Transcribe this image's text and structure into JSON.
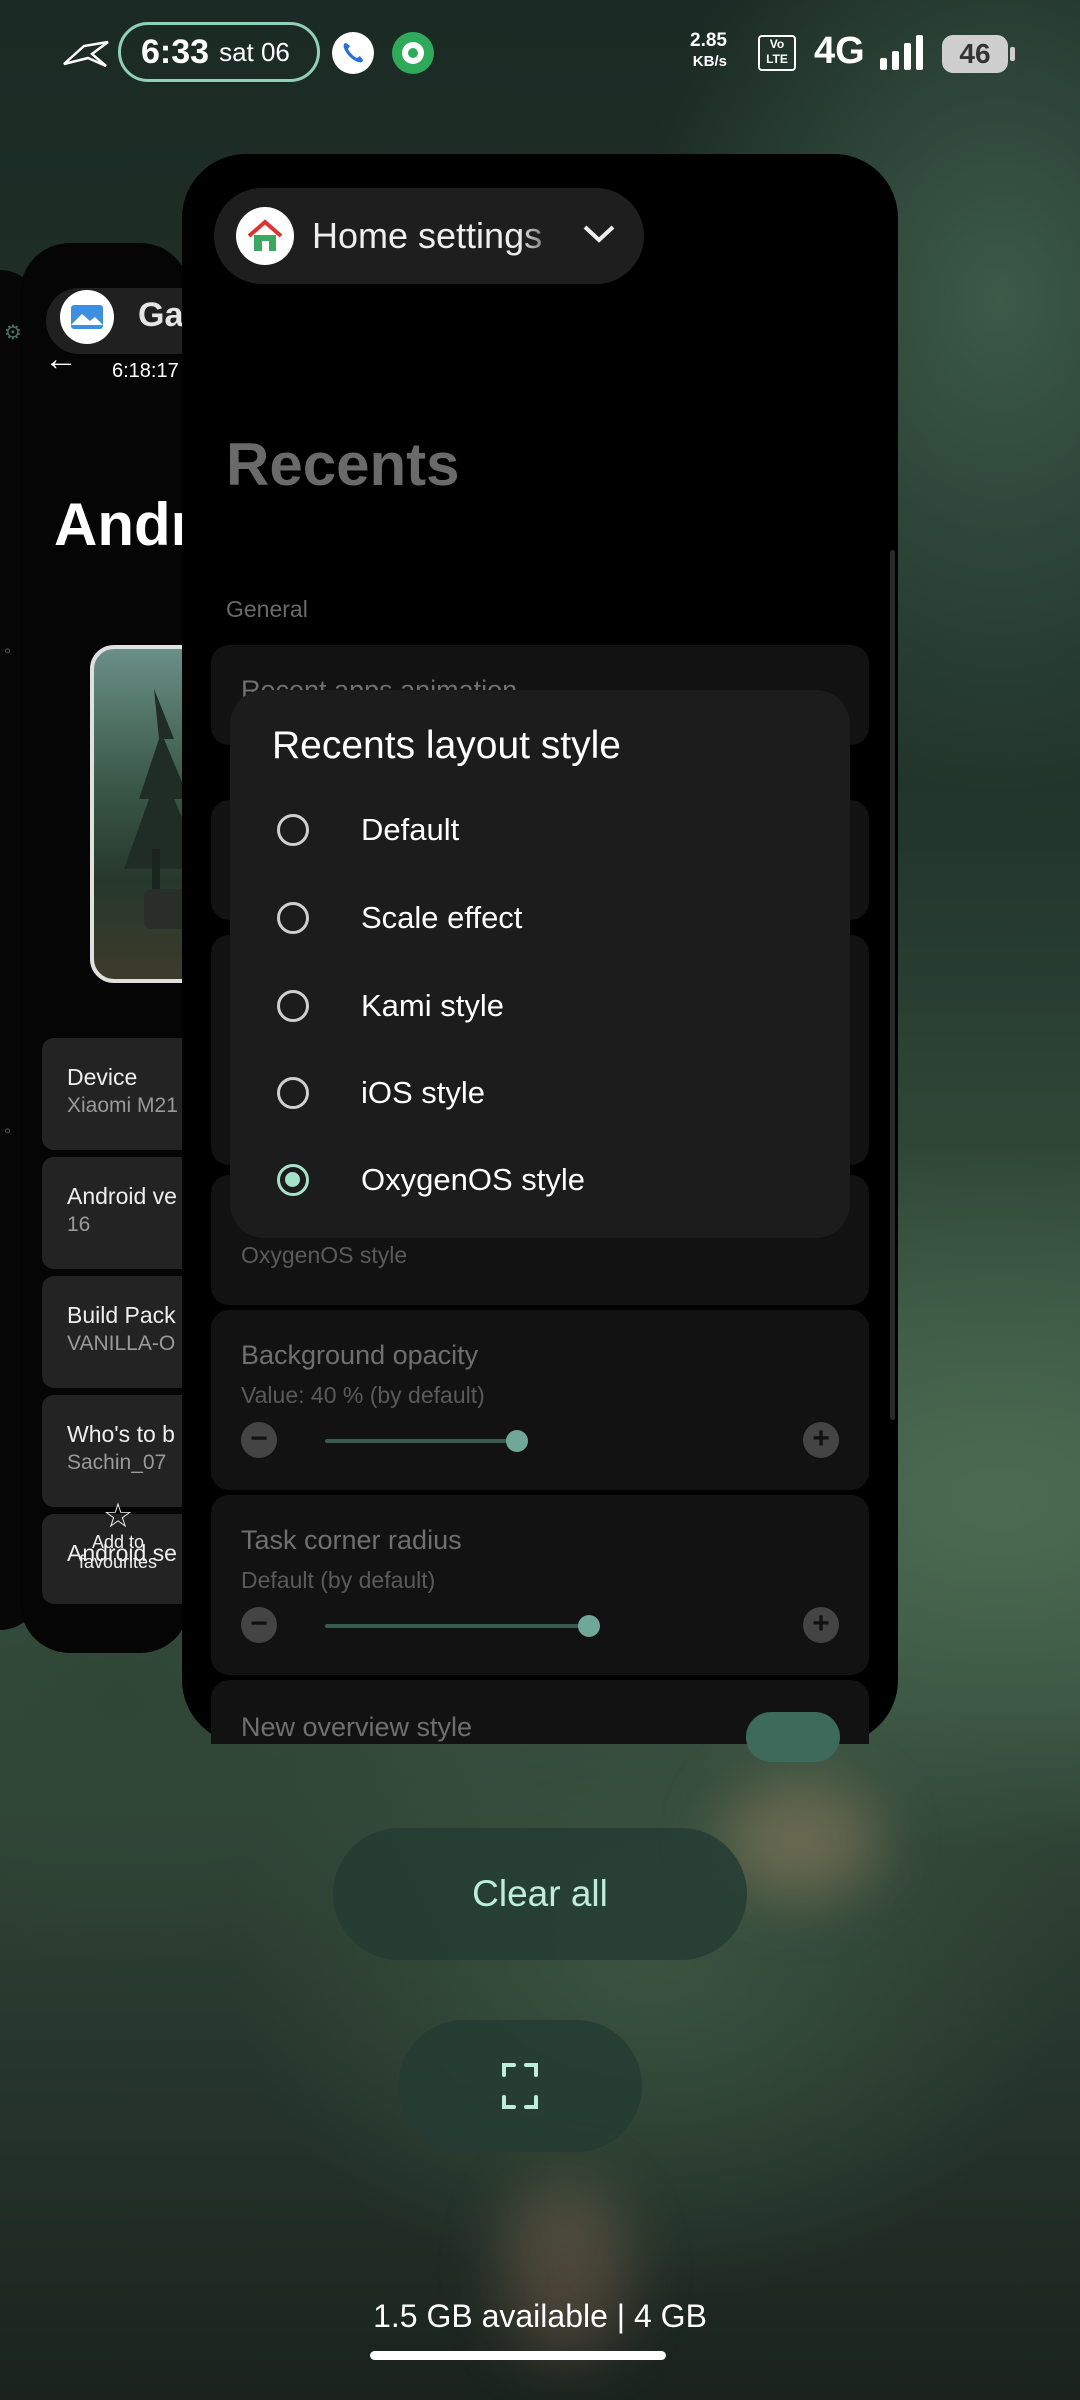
{
  "status_bar": {
    "time": "6:33",
    "date": "sat 06",
    "net_speed_value": "2.85",
    "net_speed_unit": "KB/s",
    "volte_top": "Vo",
    "volte_bottom": "LTE",
    "network": "4G",
    "battery": "46"
  },
  "left_card": {
    "app_title": "Ga",
    "time": "6:18:17",
    "heading": "Andr",
    "rows": [
      {
        "label": "Device",
        "value": "Xiaomi M21"
      },
      {
        "label": "Android ve",
        "value": "16"
      },
      {
        "label": "Build Pack",
        "value": "VANILLA-O"
      },
      {
        "label": "Who's to b",
        "value": "Sachin_07"
      },
      {
        "label": "Android se",
        "value": ""
      }
    ],
    "favourites_label": "Add to favourites"
  },
  "main_card": {
    "app_name": "Home settings",
    "title": "Recents",
    "section": "General",
    "row_partial": "Recent apps animation",
    "layout_style_value": "OxygenOS style",
    "background_opacity": {
      "label": "Background opacity",
      "sub": "Value: 40 % (by default)",
      "value_fraction": 0.4
    },
    "task_corner_radius": {
      "label": "Task corner radius",
      "sub": "Default (by default)",
      "value_fraction": 0.55
    },
    "new_overview": {
      "label": "New overview style"
    }
  },
  "dialog": {
    "title": "Recents layout style",
    "options": [
      {
        "label": "Default",
        "selected": false
      },
      {
        "label": "Scale effect",
        "selected": false
      },
      {
        "label": "Kami style",
        "selected": false
      },
      {
        "label": "iOS style",
        "selected": false
      },
      {
        "label": "OxygenOS style",
        "selected": true
      }
    ]
  },
  "bottom": {
    "clear_all": "Clear all",
    "memory": "1.5 GB available | 4 GB"
  },
  "colors": {
    "accent": "#a6e2c9",
    "clear_all_text": "#bdeedd"
  }
}
